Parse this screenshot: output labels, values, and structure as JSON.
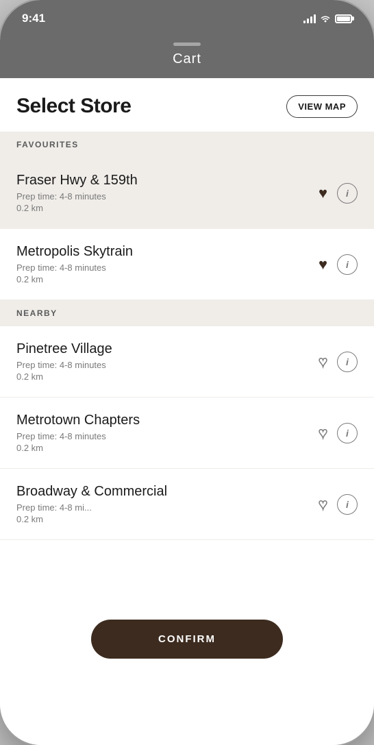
{
  "statusBar": {
    "time": "9:41"
  },
  "header": {
    "cartLabel": "Cart"
  },
  "page": {
    "title": "Select Store",
    "viewMapLabel": "VIEW MAP"
  },
  "sections": [
    {
      "label": "FAVOURITES",
      "items": [
        {
          "name": "Fraser Hwy & 159th",
          "prepTime": "Prep time: 4-8 minutes",
          "distance": "0.2 km",
          "favourited": true,
          "selected": true
        },
        {
          "name": "Metropolis Skytrain",
          "prepTime": "Prep time: 4-8 minutes",
          "distance": "0.2 km",
          "favourited": true,
          "selected": false
        }
      ]
    },
    {
      "label": "NEARBY",
      "items": [
        {
          "name": "Pinetree Village",
          "prepTime": "Prep time: 4-8 minutes",
          "distance": "0.2 km",
          "favourited": false,
          "selected": false
        },
        {
          "name": "Metrotown Chapters",
          "prepTime": "Prep time: 4-8 minutes",
          "distance": "0.2 km",
          "favourited": false,
          "selected": false
        },
        {
          "name": "Broadway & Commercial",
          "prepTime": "Prep time: 4-8 mi...",
          "distance": "0.2 km",
          "favourited": false,
          "selected": false
        }
      ]
    }
  ],
  "confirmButton": {
    "label": "CONFIRM"
  }
}
